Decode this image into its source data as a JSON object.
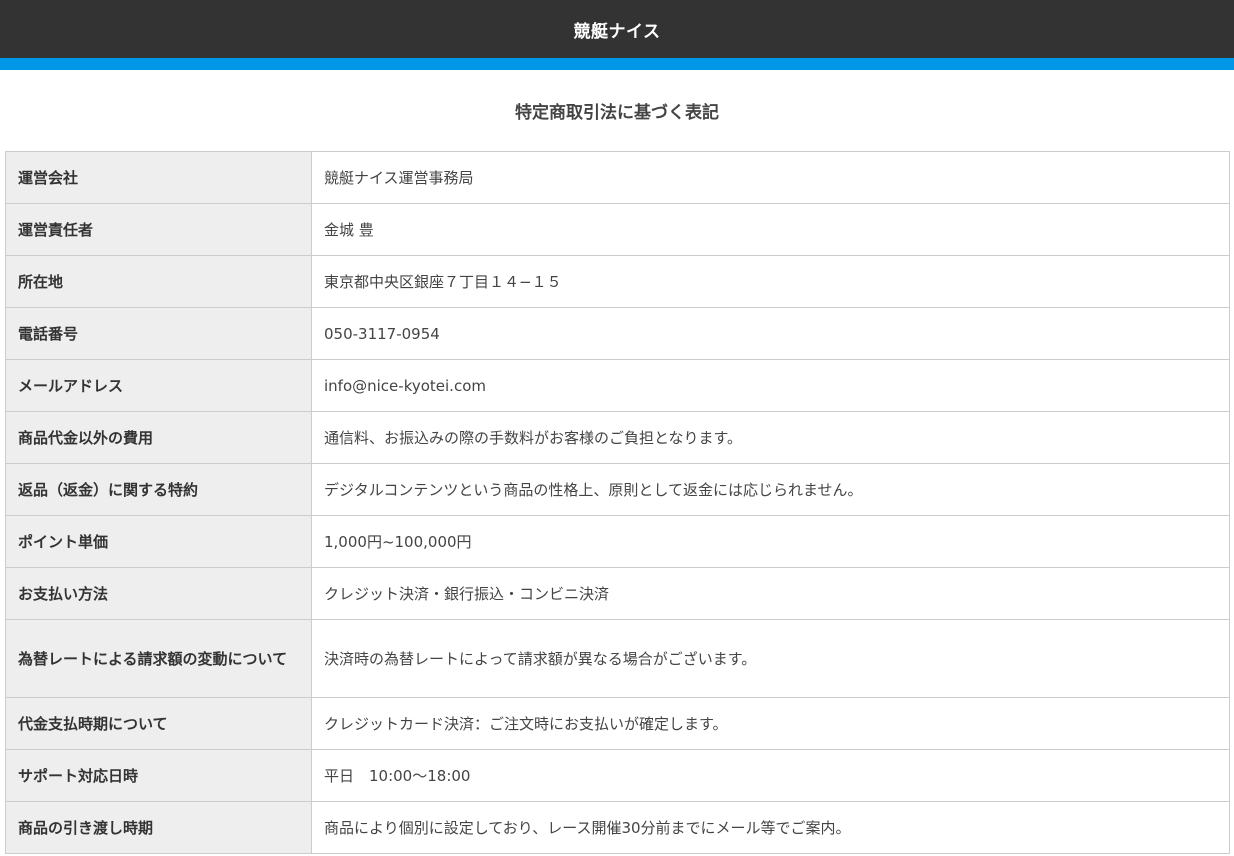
{
  "header": {
    "site_title": "競艇ナイス"
  },
  "colors": {
    "header_bg": "#333333",
    "accent": "#0097e6",
    "label_bg": "#eeeeee"
  },
  "page": {
    "title": "特定商取引法に基づく表記"
  },
  "rows": [
    {
      "label": "運営会社",
      "value": "競艇ナイス運営事務局"
    },
    {
      "label": "運営責任者",
      "value": "金城 豊"
    },
    {
      "label": "所在地",
      "value": "東京都中央区銀座７丁目１４−１５"
    },
    {
      "label": "電話番号",
      "value": "050-3117-0954"
    },
    {
      "label": "メールアドレス",
      "value": "info@nice-kyotei.com"
    },
    {
      "label": "商品代金以外の費用",
      "value": "通信料、お振込みの際の手数料がお客様のご負担となります。"
    },
    {
      "label": "返品（返金）に関する特約",
      "value": "デジタルコンテンツという商品の性格上、原則として返金には応じられません。"
    },
    {
      "label": "ポイント単価",
      "value": "1,000円~100,000円"
    },
    {
      "label": "お支払い方法",
      "value": "クレジット決済・銀行振込・コンビニ決済"
    },
    {
      "label": "為替レートによる請求額の変動について",
      "value": "決済時の為替レートによって請求額が異なる場合がございます。"
    },
    {
      "label": "代金支払時期について",
      "value": "クレジットカード決済：ご注文時にお支払いが確定します。"
    },
    {
      "label": "サポート対応日時",
      "value": "平日　10:00〜18:00"
    },
    {
      "label": "商品の引き渡し時期",
      "value": "商品により個別に設定しており、レース開催30分前までにメール等でご案内。"
    }
  ]
}
